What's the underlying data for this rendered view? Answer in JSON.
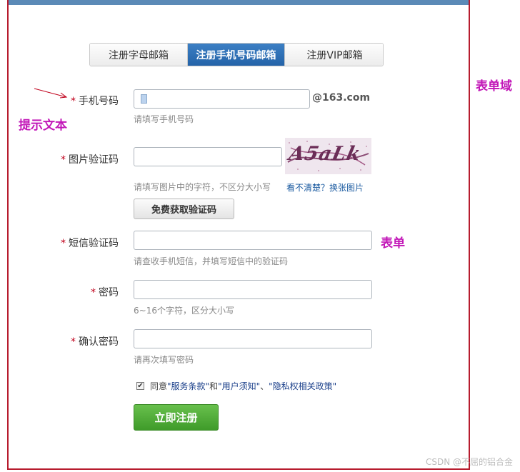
{
  "tabs": [
    {
      "label": "注册字母邮箱"
    },
    {
      "label": "注册手机号码邮箱"
    },
    {
      "label": "注册VIP邮箱"
    }
  ],
  "form": {
    "phone": {
      "label": "手机号码",
      "value": "",
      "suffix": "@163.com",
      "hint": "请填写手机号码"
    },
    "captcha": {
      "label": "图片验证码",
      "value": "",
      "hint": "请填写图片中的字符，不区分大小写",
      "refresh": "看不清楚？换张图片",
      "image_text": "A5aLk"
    },
    "sms_button": "免费获取验证码",
    "sms": {
      "label": "短信验证码",
      "value": "",
      "hint": "请查收手机短信，并填写短信中的验证码"
    },
    "password": {
      "label": "密码",
      "value": "",
      "hint": "6~16个字符，区分大小写"
    },
    "confirm": {
      "label": "确认密码",
      "value": "",
      "hint": "请再次填写密码"
    },
    "agree": {
      "checked": true,
      "prefix": "同意",
      "terms": "\"服务条款\"",
      "and": "和",
      "notice": "\"用户须知\"",
      "sep": "、",
      "privacy": "\"隐私权相关政策\""
    },
    "required_mark": "*",
    "submit": "立即注册"
  },
  "annotations": {
    "hint_text": "提示文本",
    "form_field": "表单",
    "form_area": "表单域"
  },
  "watermark": "CSDN @不屈的铝合金",
  "colors": {
    "border": "#b71c2e",
    "annotation": "#c218b8",
    "tab_active": "#2463a8",
    "submit": "#3f9b2a"
  }
}
